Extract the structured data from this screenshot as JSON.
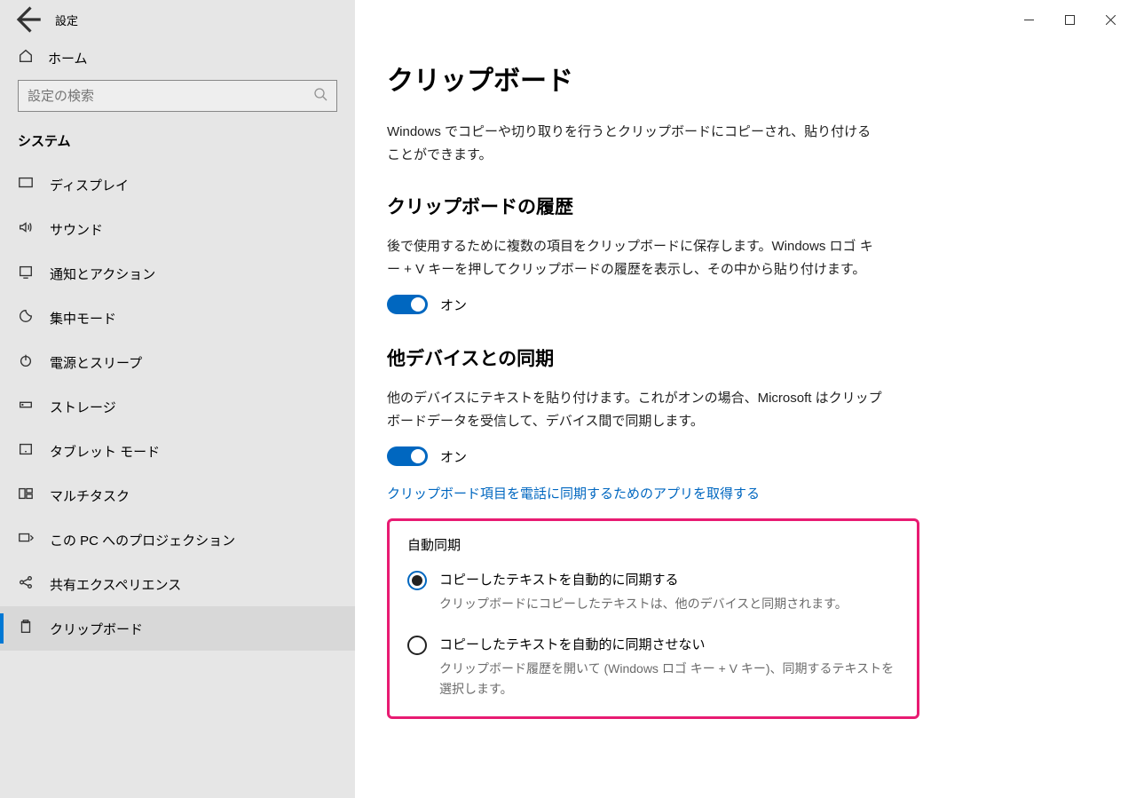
{
  "app_title": "設定",
  "home_label": "ホーム",
  "search_placeholder": "設定の検索",
  "category": "システム",
  "nav": {
    "display": "ディスプレイ",
    "sound": "サウンド",
    "notifications": "通知とアクション",
    "focus": "集中モード",
    "power": "電源とスリープ",
    "storage": "ストレージ",
    "tablet": "タブレット モード",
    "multitask": "マルチタスク",
    "projection": "この PC へのプロジェクション",
    "shared": "共有エクスペリエンス",
    "clipboard": "クリップボード"
  },
  "page": {
    "title": "クリップボード",
    "intro": "Windows でコピーや切り取りを行うとクリップボードにコピーされ、貼り付けることができます。",
    "history_h": "クリップボードの履歴",
    "history_desc": "後で使用するために複数の項目をクリップボードに保存します。Windows ロゴ キー + V キーを押してクリップボードの履歴を表示し、その中から貼り付けます。",
    "history_toggle": "オン",
    "sync_h": "他デバイスとの同期",
    "sync_desc": "他のデバイスにテキストを貼り付けます。これがオンの場合、Microsoft はクリップボードデータを受信して、デバイス間で同期します。",
    "sync_toggle": "オン",
    "sync_link": "クリップボード項目を電話に同期するためのアプリを取得する",
    "auto_h": "自動同期",
    "opt1_label": "コピーしたテキストを自動的に同期する",
    "opt1_desc": "クリップボードにコピーしたテキストは、他のデバイスと同期されます。",
    "opt2_label": "コピーしたテキストを自動的に同期させない",
    "opt2_desc": "クリップボード履歴を開いて (Windows ロゴ キー + V キー)、同期するテキストを選択します。"
  }
}
